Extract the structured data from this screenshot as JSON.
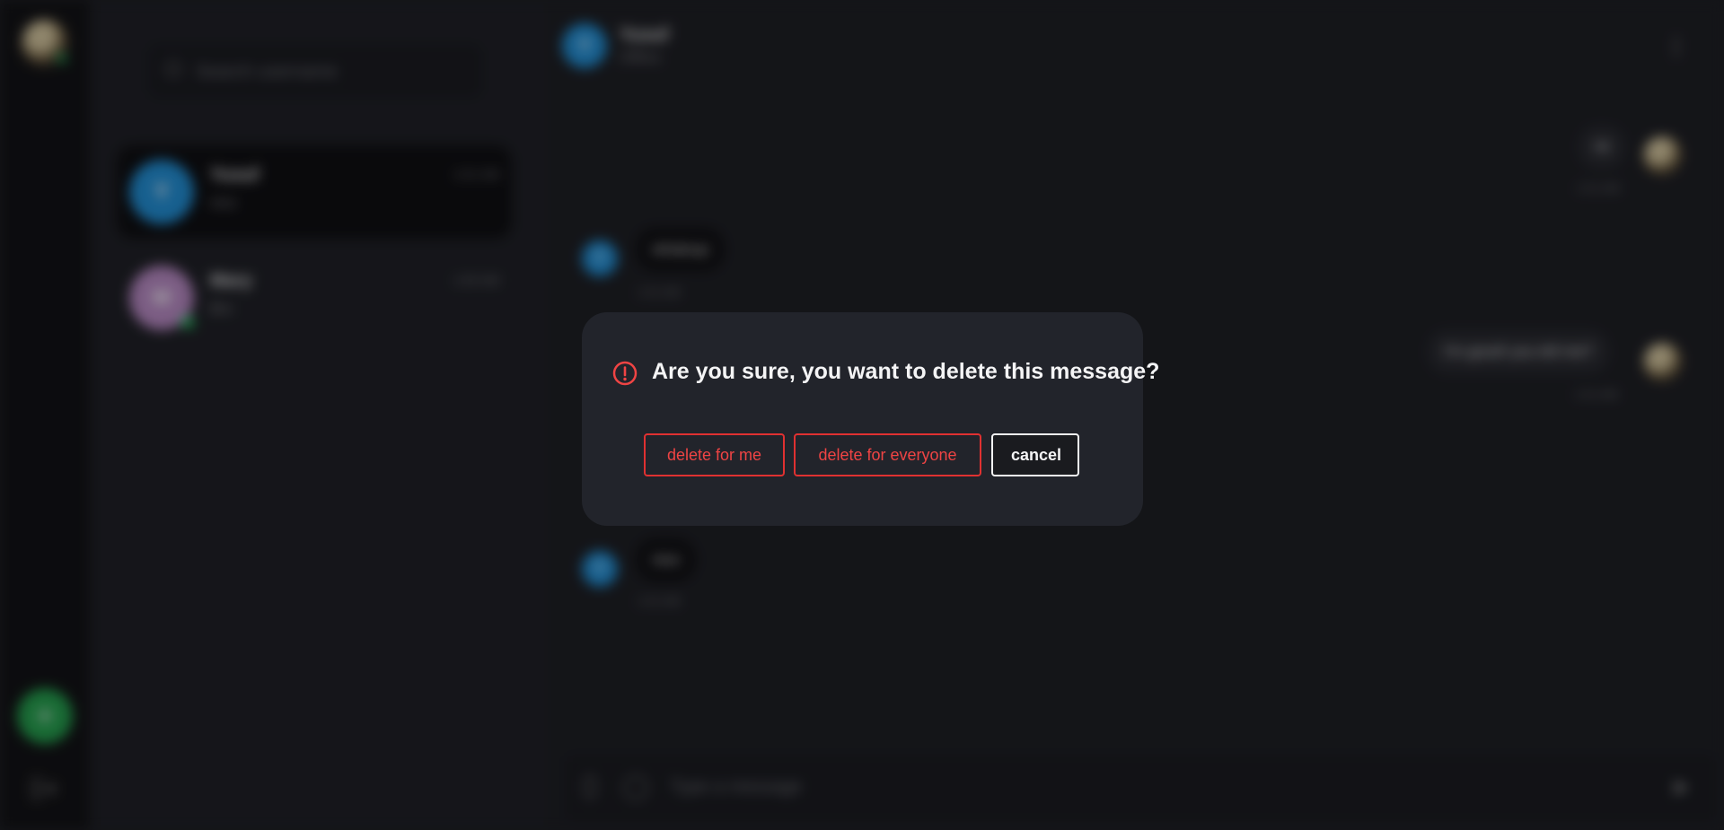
{
  "colors": {
    "accent_danger": "#e03131",
    "online": "#22c55e",
    "modal_bg": "#22242b",
    "avatar_blue": "#1f8fd6",
    "avatar_purple": "#b98ac4",
    "add_green": "#22a04b"
  },
  "rail": {
    "add_icon": "plus-icon",
    "logout_icon": "logout-icon"
  },
  "search": {
    "placeholder": "Search username",
    "icon": "search-icon"
  },
  "contacts": [
    {
      "initial": "Y",
      "name": "Yusuf",
      "time": "1:01 AM",
      "preview": "nice"
    },
    {
      "initial": "M",
      "name": "Mary",
      "time": "1:00 AM",
      "preview": "Bro"
    }
  ],
  "chat": {
    "header": {
      "initial": "Y",
      "name": "Yusuf",
      "status": "Offline"
    },
    "messages": [
      {
        "text": "Hi",
        "time": "1:01 AM"
      },
      {
        "text": "whatsup",
        "time": "1:01 AM"
      },
      {
        "text": "I'm good! you tell me?",
        "time": "1:01 AM"
      },
      {
        "text": "nice",
        "time": "1:01 AM"
      }
    ],
    "composer": {
      "placeholder": "Type a message"
    }
  },
  "modal": {
    "icon": "alert-circle-icon",
    "question": "Are you sure, you want to delete this message?",
    "delete_for_me": "delete for me",
    "delete_for_everyone": "delete for everyone",
    "cancel": "cancel"
  }
}
